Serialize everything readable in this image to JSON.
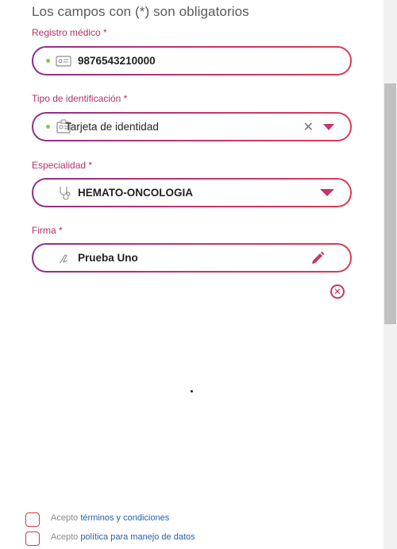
{
  "form": {
    "heading": "Los campos con (*) son obligatorios",
    "fields": [
      {
        "label": "Registro médico *",
        "value": "9876543210000",
        "icon": "id-card-icon"
      },
      {
        "label": "Tipo de identificación *",
        "value": "Tarjeta de identidad",
        "icon": "id-badge-icon",
        "clear": "✕"
      },
      {
        "label": "Especialidad *",
        "value": "HEMATO-ONCOLOGIA",
        "icon": "stethoscope-icon"
      },
      {
        "label": "Firma *",
        "value": "Prueba Uno",
        "icon": "signature-icon"
      }
    ],
    "remove_label": "✕"
  },
  "consents": [
    {
      "prefix": "Acepto",
      "link": "términos y condiciones"
    },
    {
      "prefix": "Acepto",
      "link": "política para manejo de datos"
    }
  ],
  "colors": {
    "accent": "#c8356b",
    "accent_start": "#8e2f8c",
    "valid_dot": "#8bc34a",
    "link": "#2b5fa5"
  }
}
